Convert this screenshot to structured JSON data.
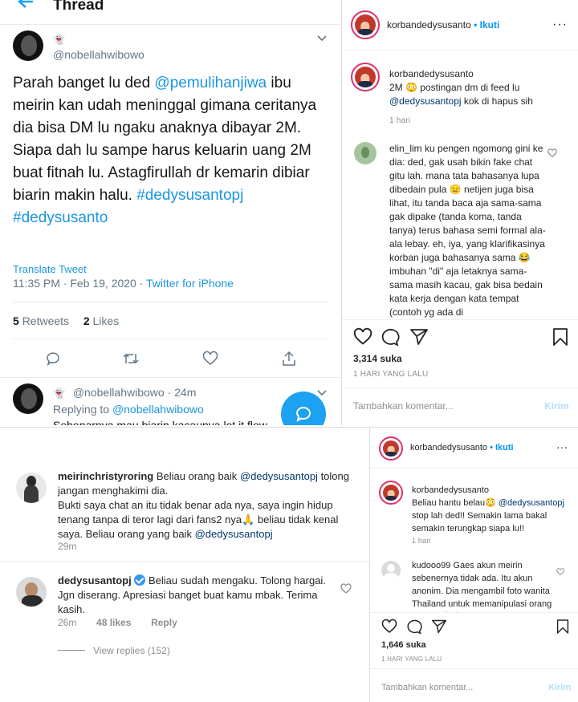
{
  "thread": {
    "title": "Thread",
    "tweet": {
      "handle": "@nobellahwibowo",
      "text_parts": [
        {
          "t": "Parah banget lu ded ",
          "link": false
        },
        {
          "t": "@pemulihanjiwa",
          "link": true
        },
        {
          "t": " ibu meirin kan udah meninggal gimana ceritanya dia bisa DM lu ngaku anaknya dibayar 2M. Siapa dah lu sampe harus keluarin uang 2M buat fitnah lu. Astagfirullah dr kemarin dibiar biarin makin halu. ",
          "link": false
        },
        {
          "t": "#dedysusantopj #dedysusanto",
          "link": true
        }
      ],
      "translate": "Translate Tweet",
      "time": "11:35 PM · Feb 19, 2020 · ",
      "source": "Twitter for iPhone",
      "retweets_count": "5",
      "retweets_label": "Retweets",
      "likes_count": "2",
      "likes_label": "Likes"
    },
    "reply": {
      "handle": "@nobellahwibowo",
      "time": "· 24m",
      "replying_prefix": "Replying to ",
      "replying_to": "@nobellahwibowo",
      "truncated": "Sebenarnya mau biarin kacaunya let it flow"
    }
  },
  "ig_post_1": {
    "username": "korbandedysusanto",
    "follow": "• Ikuti",
    "caption_user": "korbandedysusanto",
    "caption_a": "2M 😳 postingan dm di feed lu",
    "caption_mention": "@dedysusantopj",
    "caption_b": " kok di hapus sih",
    "caption_time": "1 hari",
    "comment_user": "elin_lim",
    "comment_text": "ku pengen ngomong gini ke dia: ded, gak usah bikin fake chat gitu lah. mana tata bahasanya lupa dibedain pula 😑 netijen juga bisa lihat, itu tanda baca aja sama-sama gak dipake (tanda koma, tanda tanya) terus bahasa semi formal ala-ala lebay. eh, iya, yang klarifikasinya korban juga bahasanya sama 😂 imbuhan \"di\" aja letaknya sama-sama masih kacau, gak bisa bedain kata kerja dengan kata tempat (contoh yg ada di",
    "likes": "3,314 suka",
    "date": "1 HARI YANG LALU",
    "add_comment": "Tambahkan komentar...",
    "post": "Kirim"
  },
  "ig_comments": {
    "c1_user": "meirinchristyroring",
    "c1_a": "Beliau orang baik ",
    "c1_m1": "@dedysusantopj",
    "c1_b": " tolong jangan menghakimi dia.",
    "c1_c": "Bukti saya chat an itu tidak benar ada nya, saya ingin hidup tenang tanpa di teror lagi dari fans2 nya🙏 beliau tidak kenal saya. Beliau orang yang baik ",
    "c1_m2": "@dedysusantopj",
    "c1_time": "29m",
    "c2_user": "dedysusantopj",
    "c2_text": "Beliau sudah mengaku. Tolong hargai. Jgn diserang. Apresiasi banget buat kamu mbak. Terima kasih.",
    "c2_time": "26m",
    "c2_likes": "48 likes",
    "c2_reply": "Reply",
    "view_replies": "View replies (152)"
  },
  "ig_post_2": {
    "username": "korbandedysusanto",
    "follow": "• Ikuti",
    "caption_user": "korbandedysusanto",
    "caption_a": "Beliau hantu belau😳 ",
    "caption_mention": "@dedysusantopj",
    "caption_b": " stop lah ded!! Semakin lama bakal semakin terungkap siapa lu!!",
    "caption_time": "1 hari",
    "comment_user": "kudooo99",
    "comment_text": "Gaes akun meirin sebenernya tidak ada. Itu akun anonim. Dia mengambil foto wanita Thailand untuk memanipulasi orang banyak😂😂",
    "likes": "1,646 suka",
    "date": "1 HARI YANG LALU",
    "add_comment": "Tambahkan komentar...",
    "post": "Kirim"
  }
}
